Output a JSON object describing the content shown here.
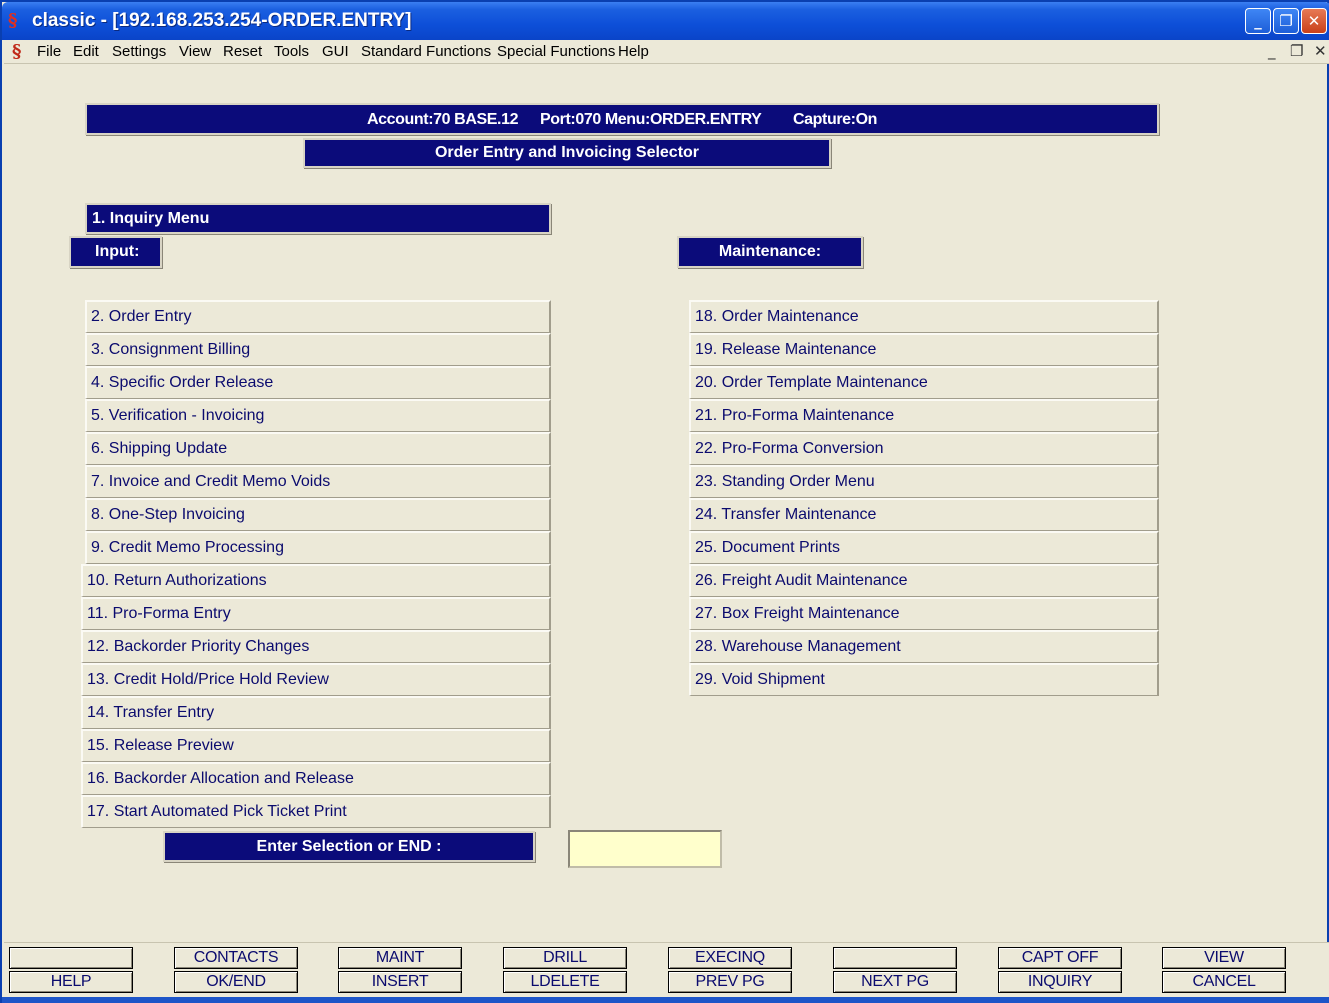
{
  "window": {
    "title": "classic - [192.168.253.254-ORDER.ENTRY]",
    "minimize_icon": "minimize-icon",
    "restore_icon": "restore-icon",
    "close_icon": "close-icon"
  },
  "menubar": {
    "items": [
      "File",
      "Edit",
      "Settings",
      "View",
      "Reset",
      "Tools",
      "GUI",
      "Standard Functions",
      "Special Functions",
      "Help"
    ]
  },
  "header": {
    "account": "Account:70 BASE.12",
    "port_menu": "Port:070 Menu:ORDER.ENTRY",
    "capture": "Capture:On",
    "selector_title": "Order Entry and Invoicing Selector"
  },
  "inquiry": {
    "label": "1. Inquiry Menu"
  },
  "input_section": {
    "label": "Input:",
    "items": [
      "2. Order Entry",
      "3. Consignment Billing",
      "4. Specific Order Release",
      "5. Verification - Invoicing",
      "6. Shipping Update",
      "7. Invoice and Credit Memo Voids",
      "8. One-Step Invoicing",
      "9. Credit Memo Processing",
      "10. Return Authorizations",
      "11. Pro-Forma Entry",
      "12. Backorder Priority Changes",
      "13. Credit Hold/Price Hold Review",
      "14. Transfer Entry",
      "15. Release Preview",
      "16. Backorder Allocation and Release",
      "17. Start Automated Pick Ticket Print"
    ]
  },
  "maintenance_section": {
    "label": "Maintenance:",
    "items": [
      "18. Order Maintenance",
      "19. Release Maintenance",
      "20. Order Template Maintenance",
      "21. Pro-Forma Maintenance",
      "22. Pro-Forma Conversion",
      "23. Standing Order Menu",
      "24. Transfer Maintenance",
      "25. Document Prints",
      "26. Freight Audit Maintenance",
      "27. Box Freight Maintenance",
      "28. Warehouse Management",
      "29. Void Shipment"
    ]
  },
  "prompt": {
    "label": "Enter Selection or END :",
    "value": ""
  },
  "function_keys": {
    "top": [
      "",
      "CONTACTS",
      "MAINT",
      "DRILL",
      "EXECINQ",
      "",
      "CAPT OFF",
      "VIEW"
    ],
    "bottom": [
      "HELP",
      "OK/END",
      "INSERT",
      "LDELETE",
      "PREV PG",
      "NEXT PG",
      "INQUIRY",
      "CANCEL"
    ]
  },
  "colors": {
    "navy": "#0b0b7a",
    "panel": "#ece9d8",
    "input_bg": "#ffffcc",
    "title_blue": "#0d4fd8"
  }
}
